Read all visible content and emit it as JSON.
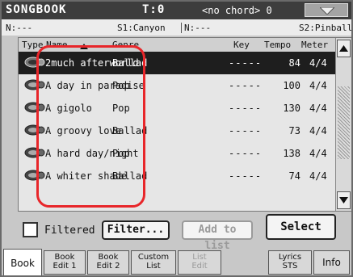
{
  "titlebar": {
    "app": "SONGBOOK",
    "tempo": "T:0",
    "chord": "<no chord> 0"
  },
  "inforow": {
    "left_n": "N:---",
    "style1": "S1:Canyon",
    "mid_n": "N:---",
    "style2": "S2:Pinball"
  },
  "columns": {
    "type": "Type",
    "name": "Name",
    "genre": "Genre",
    "key": "Key",
    "tempo": "Tempo",
    "meter": "Meter"
  },
  "songs": [
    {
      "name": "2much afterworld",
      "genre": "Ballad",
      "key": "-----",
      "tempo": "84",
      "meter": "4/4"
    },
    {
      "name": "A day in paradise",
      "genre": "Pop",
      "key": "-----",
      "tempo": "100",
      "meter": "4/4"
    },
    {
      "name": "A gigolo",
      "genre": "Pop",
      "key": "-----",
      "tempo": "130",
      "meter": "4/4"
    },
    {
      "name": "A groovy love",
      "genre": "Ballad",
      "key": "-----",
      "tempo": "73",
      "meter": "4/4"
    },
    {
      "name": "A hard day/night",
      "genre": "Pop",
      "key": "-----",
      "tempo": "138",
      "meter": "4/4"
    },
    {
      "name": "A whiter shade",
      "genre": "Ballad",
      "key": "-----",
      "tempo": "74",
      "meter": "4/4"
    }
  ],
  "buttons": {
    "filtered": "Filtered",
    "filter": "Filter...",
    "add_to_list": "Add to list",
    "select": "Select"
  },
  "tabs": [
    {
      "l1": "Book",
      "l2": ""
    },
    {
      "l1": "Book",
      "l2": "Edit 1"
    },
    {
      "l1": "Book",
      "l2": "Edit 2"
    },
    {
      "l1": "Custom",
      "l2": "List"
    },
    {
      "l1": "List",
      "l2": "Edit"
    },
    {
      "l1": "Lyrics",
      "l2": "STS"
    },
    {
      "l1": "Info",
      "l2": ""
    }
  ],
  "colors": {
    "highlight": "#e8262a",
    "titlebar": "#3d3d3d",
    "selected_row": "#1e1e1e"
  }
}
